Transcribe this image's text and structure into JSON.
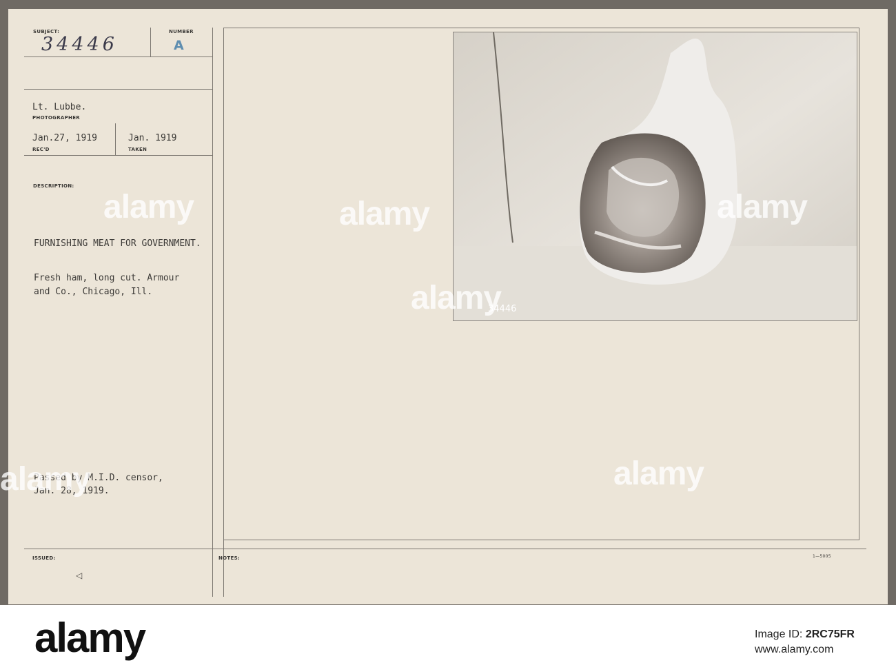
{
  "card": {
    "subject_label": "SUBJECT:",
    "subject_number": "34446",
    "number_label": "NUMBER",
    "number_stamp": "A",
    "photographer": "Lt. Lubbe.",
    "photographer_label": "PHOTOGRAPHER",
    "received_date": "Jan.27, 1919",
    "received_label": "REC'D",
    "taken_date": "Jan. 1919",
    "taken_label": "TAKEN",
    "description_label": "DESCRIPTION:",
    "description_title": "FURNISHING MEAT FOR GOVERNMENT.",
    "description_line1": "Fresh ham, long cut. Armour",
    "description_line2": "and Co., Chicago, Ill.",
    "censor_line1": "Passed by M.I.D. censor,",
    "censor_line2": "Jan. 28, 1919.",
    "issued_label": "ISSUED:",
    "notes_label": "NOTES:",
    "form_code": "1—5005",
    "photo_number": "34446"
  },
  "watermark": {
    "text": "alamy"
  },
  "footer": {
    "logo": "alamy",
    "image_id_prefix": "Image ID:",
    "image_id": "2RC75FR",
    "site": "www.alamy.com"
  }
}
